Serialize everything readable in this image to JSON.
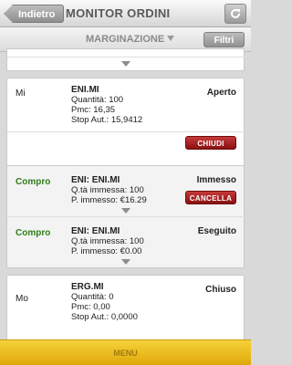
{
  "header": {
    "back_label": "Indietro",
    "title": "MONITOR ORDINI",
    "refresh_icon": "refresh-icon"
  },
  "subheader": {
    "section": "MARGINAZIONE",
    "filter_label": "Filtri"
  },
  "orders": [
    {
      "side": "Mi",
      "ticker": "ENI.MI",
      "lines": [
        "Quantità: 100",
        "Pmc: 16,35",
        "Stop Aut.: 15,9412"
      ],
      "status": "Aperto",
      "action": "CHIUDI"
    },
    {
      "side": "Compro",
      "ticker": "ENI: ENI.MI",
      "lines": [
        "Q.tà immessa: 100",
        "P. immesso: €16.29"
      ],
      "status": "Immesso",
      "action": "CANCELLA"
    },
    {
      "side": "Compro",
      "ticker": "ENI: ENI.MI",
      "lines": [
        "Q.tà immessa: 100",
        "P. immesso: €0.00"
      ],
      "status": "Eseguito"
    },
    {
      "side": "Mo",
      "ticker": "ERG.MI",
      "lines": [
        "Quantità: 0",
        "Pmc: 0,00",
        "Stop Aut.: 0,0000"
      ],
      "status": "Chiuso"
    }
  ],
  "footer": {
    "menu_label": "MENU"
  },
  "colors": {
    "buy": "#2e7d17",
    "action_red": "#b02020",
    "menu_yellow": "#f0c020"
  }
}
